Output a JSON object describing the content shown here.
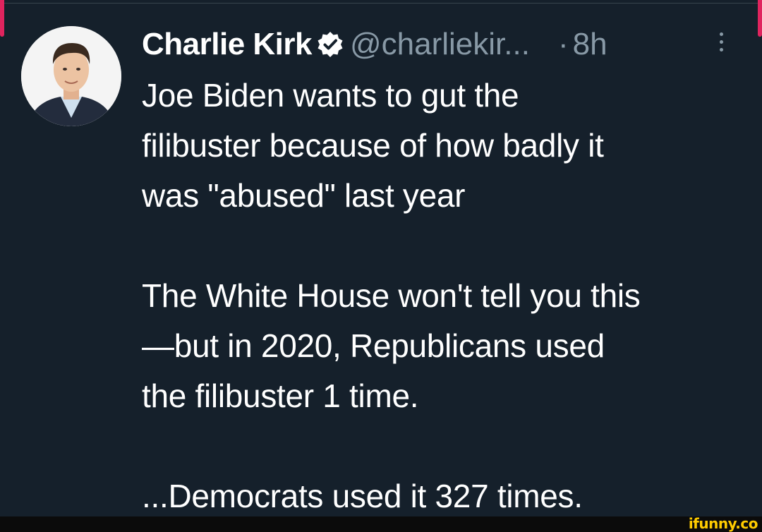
{
  "tweet": {
    "author_name": "Charlie Kirk",
    "author_handle": "@charliekir...",
    "separator": "·",
    "time_ago": "8h",
    "verified": true,
    "lines": [
      "Joe Biden wants to gut the",
      "filibuster because of how badly it",
      "was \"abused\" last year",
      "",
      "The White House won't tell you this",
      "—but in 2020, Republicans used",
      "the filibuster 1 time.",
      "",
      "...Democrats used it 327 times."
    ]
  },
  "icons": {
    "verified": "verified-badge-icon",
    "more": "more-vertical-icon"
  },
  "colors": {
    "background": "#15202b",
    "primary_text": "#ffffff",
    "secondary_text": "#8899a6",
    "accent_edge": "#e0245e",
    "watermark": "#ffcc00"
  },
  "watermark": "ifunny.co"
}
